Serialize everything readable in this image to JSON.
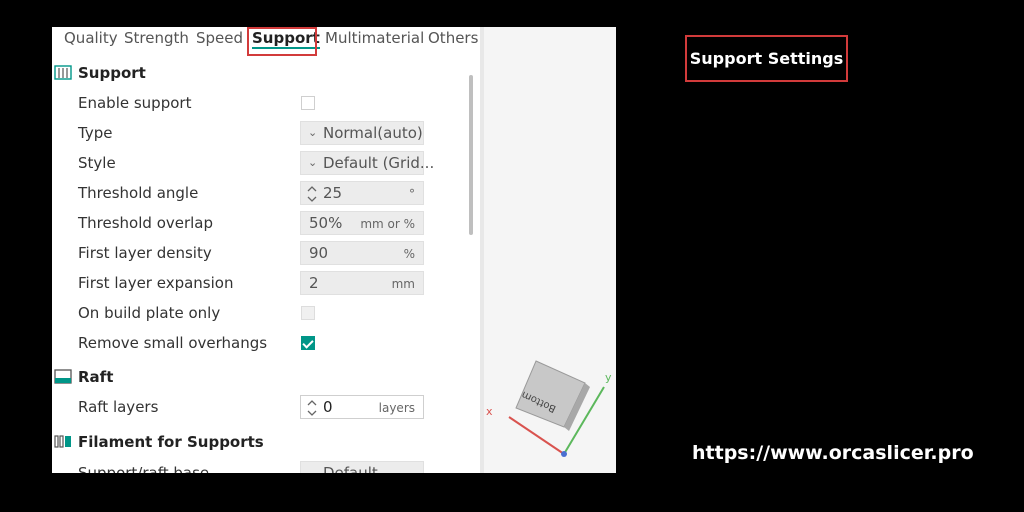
{
  "tabs": [
    {
      "label": "Quality"
    },
    {
      "label": "Strength"
    },
    {
      "label": "Speed"
    },
    {
      "label": "Support"
    },
    {
      "label": "Multimaterial"
    },
    {
      "label": "Others"
    }
  ],
  "active_tab": "Support",
  "sections": {
    "support": {
      "title": "Support"
    },
    "raft": {
      "title": "Raft"
    },
    "filament": {
      "title": "Filament for Supports"
    }
  },
  "support_settings": {
    "enable_support": {
      "label": "Enable support",
      "checked": false
    },
    "type": {
      "label": "Type",
      "value": "Normal(auto)"
    },
    "style": {
      "label": "Style",
      "value": "Default (Grid..."
    },
    "threshold_angle": {
      "label": "Threshold angle",
      "value": "25",
      "unit": "°"
    },
    "threshold_overlap": {
      "label": "Threshold overlap",
      "value": "50%",
      "unit": "mm or %"
    },
    "first_layer_density": {
      "label": "First layer density",
      "value": "90",
      "unit": "%"
    },
    "first_layer_expansion": {
      "label": "First layer expansion",
      "value": "2",
      "unit": "mm"
    },
    "on_build_plate_only": {
      "label": "On build plate only",
      "checked": false
    },
    "remove_small_overhangs": {
      "label": "Remove small overhangs",
      "checked": true
    }
  },
  "raft_settings": {
    "raft_layers": {
      "label": "Raft layers",
      "value": "0",
      "unit": "layers"
    }
  },
  "filament_settings": {
    "support_raft_base": {
      "label": "Support/raft base",
      "value": "Default"
    }
  },
  "viewport": {
    "cube_face_label": "Bottom",
    "axis_x_label": "x",
    "axis_y_label": "y"
  },
  "callout_label": "Support Settings",
  "website_url": "https://www.orcaslicer.pro",
  "colors": {
    "accent": "#009688",
    "highlight_border": "#d23b3b",
    "axis_x": "#d9534f",
    "axis_y": "#5cb85c",
    "axis_z": "#4a6fd1"
  }
}
